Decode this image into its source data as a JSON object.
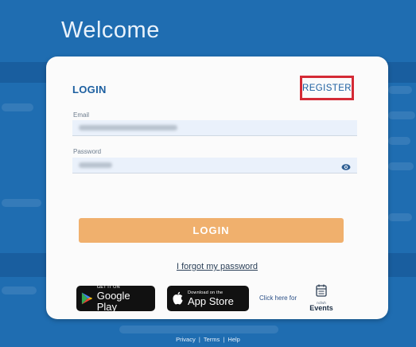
{
  "header": {
    "title": "Welcome"
  },
  "form": {
    "login_tab": "LOGIN",
    "register_tab": "REGISTER",
    "email_label": "Email",
    "password_label": "Password",
    "submit_label": "LOGIN",
    "forgot_link": "I forgot my password"
  },
  "apps": {
    "google_small": "GET IT ON",
    "google_big": "Google Play",
    "apple_small": "Download on the",
    "apple_big": "App Store",
    "click_here": "Click here for",
    "events_small": "ncfwh",
    "events_label": "Events"
  },
  "footer": {
    "privacy": "Privacy",
    "sep": "|",
    "terms": "Terms",
    "help": "Help"
  },
  "colors": {
    "background": "#1f6db1",
    "accent": "#1c5fa0",
    "login_button": "#f0b06d",
    "register_highlight": "#d42a35"
  }
}
